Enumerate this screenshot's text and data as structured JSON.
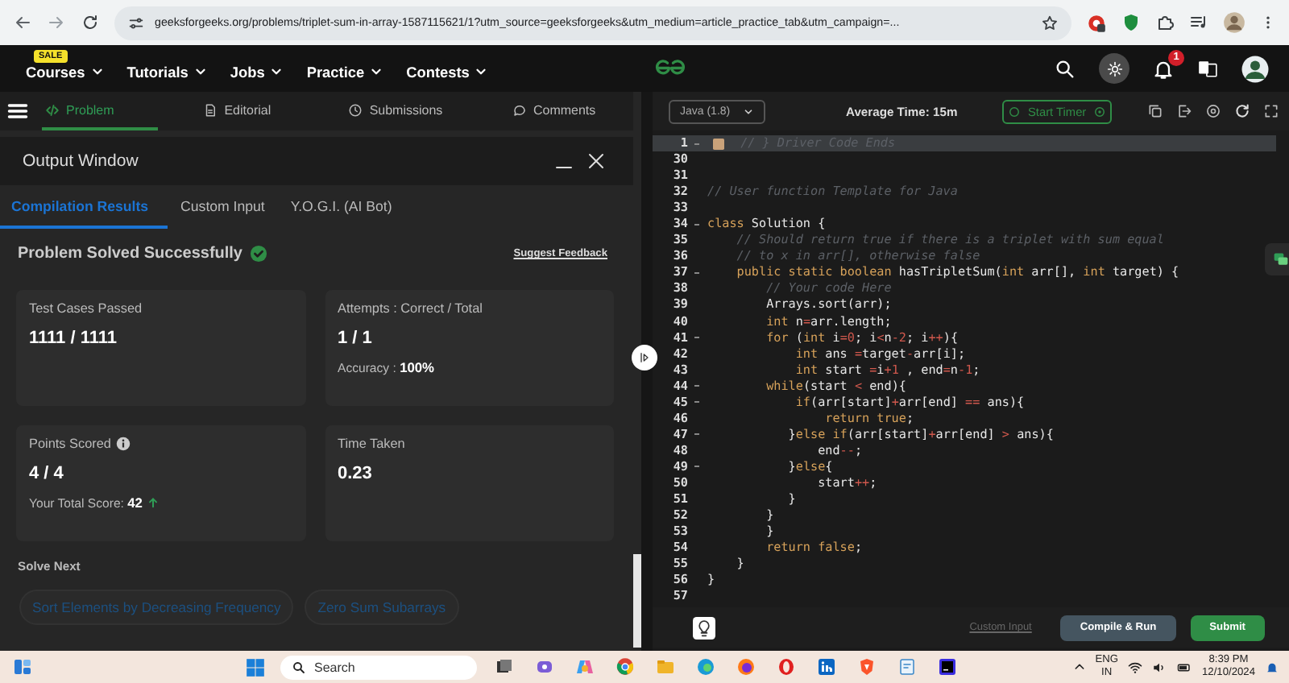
{
  "browser": {
    "url": "geeksforgeeks.org/problems/triplet-sum-in-array-1587115621/1?utm_source=geeksforgeeks&utm_medium=article_practice_tab&utm_campaign=..."
  },
  "site_nav": {
    "items": [
      {
        "label": "Courses",
        "badge": "SALE"
      },
      {
        "label": "Tutorials"
      },
      {
        "label": "Jobs"
      },
      {
        "label": "Practice"
      },
      {
        "label": "Contests"
      }
    ],
    "notification_count": "1"
  },
  "problem_tabs": [
    {
      "label": "Problem",
      "kind": "code",
      "selected": true
    },
    {
      "label": "Editorial",
      "kind": "document",
      "selected": false
    },
    {
      "label": "Submissions",
      "kind": "clock",
      "selected": false
    },
    {
      "label": "Comments",
      "kind": "comment",
      "selected": false
    }
  ],
  "output_window": {
    "title": "Output Window",
    "tabs": [
      {
        "label": "Compilation Results",
        "selected": true
      },
      {
        "label": "Custom Input",
        "selected": false
      },
      {
        "label": "Y.O.G.I. (AI Bot)",
        "selected": false
      }
    ],
    "status": "Problem Solved Successfully",
    "feedback_link": "Suggest Feedback",
    "cards": [
      {
        "label": "Test Cases Passed",
        "info": false,
        "value": "1111 / 1111"
      },
      {
        "label": "Attempts : Correct / Total",
        "info": false,
        "value": "1 / 1",
        "note": "Accuracy : **100%**"
      },
      {
        "label": "Points Scored",
        "info": true,
        "value": "4 / 4",
        "note": "Your Total Score: **42**",
        "trend_up": true
      },
      {
        "label": "Time Taken",
        "info": false,
        "value": "0.23"
      }
    ],
    "solve_next": {
      "title": "Solve Next",
      "items": [
        "Sort Elements by Decreasing Frequency",
        "Zero Sum Subarrays"
      ]
    }
  },
  "editor": {
    "language": "Java (1.8)",
    "average_time": "Average Time: 15m",
    "timer_button": "Start Timer",
    "lines": [
      {
        "number": "1",
        "fold": true,
        "selected": true,
        "segments": [
          {
            "kind": "fold-marker"
          },
          {
            "kind": "comment",
            "text": " // } Driver Code Ends"
          }
        ]
      },
      {
        "number": "30",
        "fold": false,
        "selected": false
      },
      {
        "number": "31",
        "fold": false,
        "selected": false
      },
      {
        "number": "32",
        "fold": false,
        "selected": false,
        "segments": [
          {
            "kind": "comment",
            "text": "// User function Template for Java"
          }
        ]
      },
      {
        "number": "33",
        "fold": false,
        "selected": false
      },
      {
        "number": "34",
        "fold": true,
        "selected": false,
        "segments": [
          {
            "kind": "keyword",
            "text": "class"
          },
          {
            "kind": "plain",
            "text": " Solution {"
          }
        ]
      },
      {
        "number": "35",
        "fold": false,
        "selected": false,
        "segments": [
          {
            "kind": "comment",
            "text": "    // Should return true if there is a triplet with sum equal"
          }
        ]
      },
      {
        "number": "36",
        "fold": false,
        "selected": false,
        "segments": [
          {
            "kind": "comment",
            "text": "    // to x in arr[], otherwise false"
          }
        ]
      },
      {
        "number": "37",
        "fold": true,
        "selected": false,
        "segments": [
          {
            "kind": "keyword",
            "text": "    public static boolean"
          },
          {
            "kind": "plain",
            "text": " hasTripletSum("
          },
          {
            "kind": "keyword",
            "text": "int"
          },
          {
            "kind": "plain",
            "text": " arr[], "
          },
          {
            "kind": "keyword",
            "text": "int"
          },
          {
            "kind": "plain",
            "text": " target) {"
          }
        ]
      },
      {
        "number": "38",
        "fold": false,
        "selected": false,
        "segments": [
          {
            "kind": "comment",
            "text": "        // Your code Here"
          }
        ]
      },
      {
        "number": "39",
        "fold": false,
        "selected": false,
        "segments": [
          {
            "kind": "plain",
            "text": "        Arrays.sort(arr);"
          }
        ]
      },
      {
        "number": "40",
        "fold": false,
        "selected": false,
        "segments": [
          {
            "kind": "keyword",
            "text": "        int"
          },
          {
            "kind": "plain",
            "text": " n"
          },
          {
            "kind": "literal",
            "text": "="
          },
          {
            "kind": "plain",
            "text": "arr.length;"
          }
        ]
      },
      {
        "number": "41",
        "fold": true,
        "selected": false,
        "segments": [
          {
            "kind": "keyword",
            "text": "        for"
          },
          {
            "kind": "plain",
            "text": " ("
          },
          {
            "kind": "keyword",
            "text": "int"
          },
          {
            "kind": "plain",
            "text": " i"
          },
          {
            "kind": "literal",
            "text": "=0"
          },
          {
            "kind": "plain",
            "text": "; i"
          },
          {
            "kind": "literal",
            "text": "<"
          },
          {
            "kind": "plain",
            "text": "n"
          },
          {
            "kind": "literal",
            "text": "-2"
          },
          {
            "kind": "plain",
            "text": "; i"
          },
          {
            "kind": "literal",
            "text": "++"
          },
          {
            "kind": "plain",
            "text": "){"
          }
        ]
      },
      {
        "number": "42",
        "fold": false,
        "selected": false,
        "segments": [
          {
            "kind": "keyword",
            "text": "            int"
          },
          {
            "kind": "plain",
            "text": " ans "
          },
          {
            "kind": "literal",
            "text": "="
          },
          {
            "kind": "plain",
            "text": "target"
          },
          {
            "kind": "literal",
            "text": "-"
          },
          {
            "kind": "plain",
            "text": "arr[i];"
          }
        ]
      },
      {
        "number": "43",
        "fold": false,
        "selected": false,
        "segments": [
          {
            "kind": "keyword",
            "text": "            int"
          },
          {
            "kind": "plain",
            "text": " start "
          },
          {
            "kind": "literal",
            "text": "="
          },
          {
            "kind": "plain",
            "text": "i"
          },
          {
            "kind": "literal",
            "text": "+1"
          },
          {
            "kind": "plain",
            "text": " , end"
          },
          {
            "kind": "literal",
            "text": "="
          },
          {
            "kind": "plain",
            "text": "n"
          },
          {
            "kind": "literal",
            "text": "-1"
          },
          {
            "kind": "plain",
            "text": ";"
          }
        ]
      },
      {
        "number": "44",
        "fold": true,
        "selected": false,
        "segments": [
          {
            "kind": "keyword",
            "text": "        while"
          },
          {
            "kind": "plain",
            "text": "(start "
          },
          {
            "kind": "literal",
            "text": "<"
          },
          {
            "kind": "plain",
            "text": " end){"
          }
        ]
      },
      {
        "number": "45",
        "fold": true,
        "selected": false,
        "segments": [
          {
            "kind": "keyword",
            "text": "            if"
          },
          {
            "kind": "plain",
            "text": "(arr[start]"
          },
          {
            "kind": "literal",
            "text": "+"
          },
          {
            "kind": "plain",
            "text": "arr[end] "
          },
          {
            "kind": "literal",
            "text": "=="
          },
          {
            "kind": "plain",
            "text": " ans){"
          }
        ]
      },
      {
        "number": "46",
        "fold": false,
        "selected": false,
        "segments": [
          {
            "kind": "keyword",
            "text": "                return true"
          },
          {
            "kind": "plain",
            "text": ";"
          }
        ]
      },
      {
        "number": "47",
        "fold": true,
        "selected": false,
        "segments": [
          {
            "kind": "plain",
            "text": "           }"
          },
          {
            "kind": "keyword",
            "text": "else if"
          },
          {
            "kind": "plain",
            "text": "(arr[start]"
          },
          {
            "kind": "literal",
            "text": "+"
          },
          {
            "kind": "plain",
            "text": "arr[end] "
          },
          {
            "kind": "literal",
            "text": ">"
          },
          {
            "kind": "plain",
            "text": " ans){"
          }
        ]
      },
      {
        "number": "48",
        "fold": false,
        "selected": false,
        "segments": [
          {
            "kind": "plain",
            "text": "               end"
          },
          {
            "kind": "literal",
            "text": "--"
          },
          {
            "kind": "plain",
            "text": ";"
          }
        ]
      },
      {
        "number": "49",
        "fold": true,
        "selected": false,
        "segments": [
          {
            "kind": "plain",
            "text": "           }"
          },
          {
            "kind": "keyword",
            "text": "else"
          },
          {
            "kind": "plain",
            "text": "{"
          }
        ]
      },
      {
        "number": "50",
        "fold": false,
        "selected": false,
        "segments": [
          {
            "kind": "plain",
            "text": "               start"
          },
          {
            "kind": "literal",
            "text": "++"
          },
          {
            "kind": "plain",
            "text": ";"
          }
        ]
      },
      {
        "number": "51",
        "fold": false,
        "selected": false,
        "segments": [
          {
            "kind": "plain",
            "text": "           }"
          }
        ]
      },
      {
        "number": "52",
        "fold": false,
        "selected": false,
        "segments": [
          {
            "kind": "plain",
            "text": "        }"
          }
        ]
      },
      {
        "number": "53",
        "fold": false,
        "selected": false,
        "segments": [
          {
            "kind": "plain",
            "text": "        }"
          }
        ]
      },
      {
        "number": "54",
        "fold": false,
        "selected": false,
        "segments": [
          {
            "kind": "keyword",
            "text": "        return false"
          },
          {
            "kind": "plain",
            "text": ";"
          }
        ]
      },
      {
        "number": "55",
        "fold": false,
        "selected": false,
        "segments": [
          {
            "kind": "plain",
            "text": "    }"
          }
        ]
      },
      {
        "number": "56",
        "fold": false,
        "selected": false,
        "segments": [
          {
            "kind": "plain",
            "text": "}"
          }
        ]
      },
      {
        "number": "57",
        "fold": false,
        "selected": false
      }
    ],
    "custom_input_link": "Custom Input",
    "compile_button": "Compile & Run",
    "submit_button": "Submit"
  },
  "taskbar": {
    "search_placeholder": "Search",
    "language": "ENG",
    "region": "IN",
    "time": "8:39 PM",
    "date": "12/10/2024"
  }
}
